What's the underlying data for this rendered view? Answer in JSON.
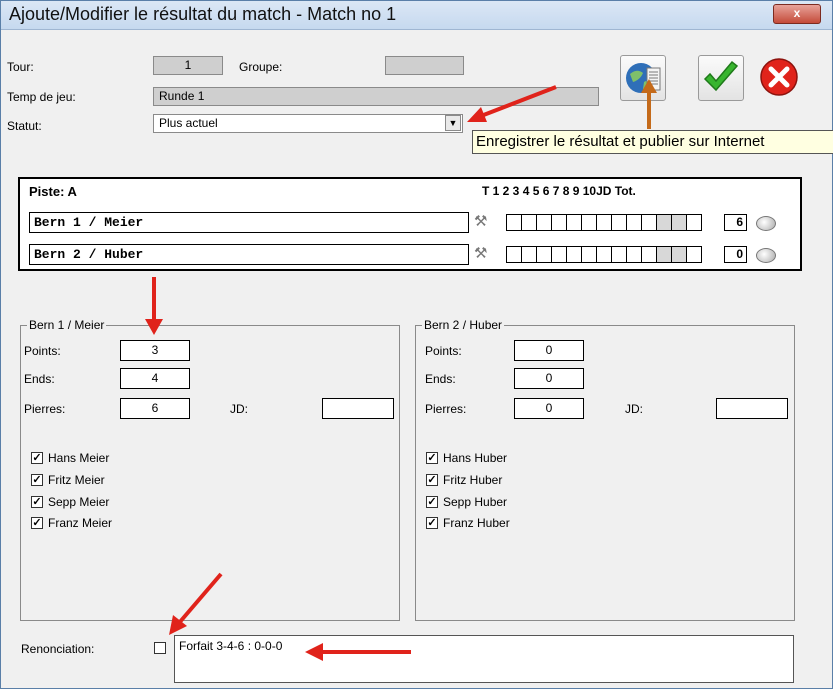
{
  "window": {
    "title": "Ajoute/Modifier le résultat du match - Match no 1",
    "close_glyph": "x"
  },
  "form": {
    "tour_label": "Tour:",
    "tour_value": "1",
    "groupe_label": "Groupe:",
    "groupe_value": "",
    "temp_label": "Temp de jeu:",
    "temp_value": "Runde 1",
    "statut_label": "Statut:",
    "statut_value": "Plus actuel"
  },
  "tooltip": "Enregistrer le résultat et publier sur Internet",
  "piste": {
    "title": "Piste: A",
    "headers": "T   1  2  3  4  5  6  7  8  9 10JD  Tot.",
    "teams": [
      {
        "name": "Bern 1 / Meier",
        "total": "6"
      },
      {
        "name": "Bern 2 / Huber",
        "total": "0"
      }
    ]
  },
  "team1": {
    "legend": "Bern 1 / Meier",
    "points_label": "Points:",
    "points": "3",
    "ends_label": "Ends:",
    "ends": "4",
    "pierres_label": "Pierres:",
    "pierres": "6",
    "jd_label": "JD:",
    "jd": "",
    "players": [
      "Hans Meier",
      "Fritz Meier",
      "Sepp Meier",
      "Franz Meier"
    ]
  },
  "team2": {
    "legend": "Bern 2 / Huber",
    "points_label": "Points:",
    "points": "0",
    "ends_label": "Ends:",
    "ends": "0",
    "pierres_label": "Pierres:",
    "pierres": "0",
    "jd_label": "JD:",
    "jd": "",
    "players": [
      "Hans Huber",
      "Fritz Huber",
      "Sepp Huber",
      "Franz Huber"
    ]
  },
  "renonciation": {
    "label": "Renonciation:",
    "text": "Forfait 3-4-6 : 0-0-0"
  },
  "icons": [
    "globe-publish-icon",
    "checkmark-icon",
    "cancel-icon",
    "hammer-icon",
    "stone-icon",
    "dropdown-arrow-icon"
  ],
  "colors": {
    "accent": "#e0231b",
    "tooltip_bg": "#ffffe1",
    "tooltip_arrow": "#c46a1a"
  }
}
